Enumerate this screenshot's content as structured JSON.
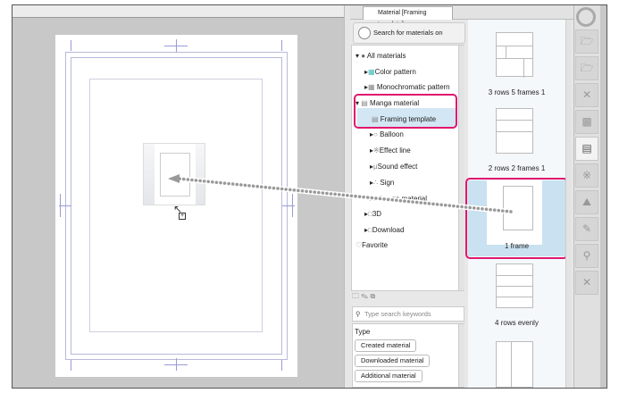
{
  "panel": {
    "tab_title": "Material [Framing template]",
    "assets_button": "Search for materials on ASSETS"
  },
  "tree": [
    {
      "label": "All materials",
      "expanded": true
    },
    {
      "label": "Color pattern"
    },
    {
      "label": "Monochromatic pattern"
    },
    {
      "label": "Manga material",
      "expanded": true
    },
    {
      "label": "Framing template",
      "selected": true
    },
    {
      "label": "Balloon"
    },
    {
      "label": "Effect line"
    },
    {
      "label": "Sound effect"
    },
    {
      "label": "Sign"
    },
    {
      "label": "Image material"
    },
    {
      "label": "3D"
    },
    {
      "label": "Download"
    },
    {
      "label": "Favorite"
    }
  ],
  "search": {
    "placeholder": "Type search keywords"
  },
  "filter": {
    "heading": "Type",
    "buttons": [
      "Created material",
      "Downloaded material",
      "Additional material"
    ]
  },
  "thumbnails": [
    {
      "label": "3 rows 5 frames 1"
    },
    {
      "label": "2 rows 2 frames 1"
    },
    {
      "label": "1 frame",
      "selected": true
    },
    {
      "label": "4 rows evenly"
    }
  ],
  "colors": {
    "highlight": "#e0176f",
    "selection": "#c9e1f0"
  }
}
